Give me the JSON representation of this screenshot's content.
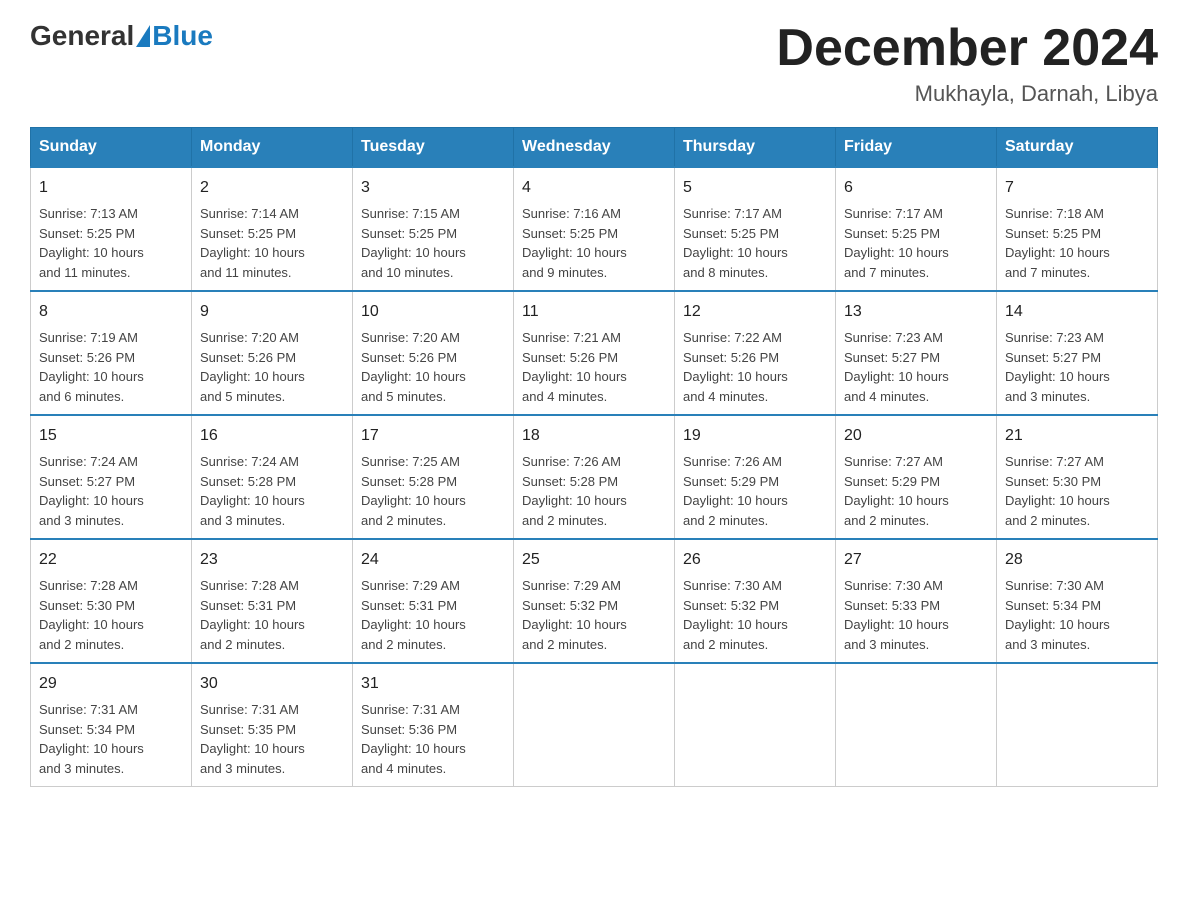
{
  "header": {
    "logo_general": "General",
    "logo_blue": "Blue",
    "month_title": "December 2024",
    "location": "Mukhayla, Darnah, Libya"
  },
  "weekdays": [
    "Sunday",
    "Monday",
    "Tuesday",
    "Wednesday",
    "Thursday",
    "Friday",
    "Saturday"
  ],
  "weeks": [
    [
      {
        "day": "1",
        "sunrise": "7:13 AM",
        "sunset": "5:25 PM",
        "daylight": "10 hours and 11 minutes."
      },
      {
        "day": "2",
        "sunrise": "7:14 AM",
        "sunset": "5:25 PM",
        "daylight": "10 hours and 11 minutes."
      },
      {
        "day": "3",
        "sunrise": "7:15 AM",
        "sunset": "5:25 PM",
        "daylight": "10 hours and 10 minutes."
      },
      {
        "day": "4",
        "sunrise": "7:16 AM",
        "sunset": "5:25 PM",
        "daylight": "10 hours and 9 minutes."
      },
      {
        "day": "5",
        "sunrise": "7:17 AM",
        "sunset": "5:25 PM",
        "daylight": "10 hours and 8 minutes."
      },
      {
        "day": "6",
        "sunrise": "7:17 AM",
        "sunset": "5:25 PM",
        "daylight": "10 hours and 7 minutes."
      },
      {
        "day": "7",
        "sunrise": "7:18 AM",
        "sunset": "5:25 PM",
        "daylight": "10 hours and 7 minutes."
      }
    ],
    [
      {
        "day": "8",
        "sunrise": "7:19 AM",
        "sunset": "5:26 PM",
        "daylight": "10 hours and 6 minutes."
      },
      {
        "day": "9",
        "sunrise": "7:20 AM",
        "sunset": "5:26 PM",
        "daylight": "10 hours and 5 minutes."
      },
      {
        "day": "10",
        "sunrise": "7:20 AM",
        "sunset": "5:26 PM",
        "daylight": "10 hours and 5 minutes."
      },
      {
        "day": "11",
        "sunrise": "7:21 AM",
        "sunset": "5:26 PM",
        "daylight": "10 hours and 4 minutes."
      },
      {
        "day": "12",
        "sunrise": "7:22 AM",
        "sunset": "5:26 PM",
        "daylight": "10 hours and 4 minutes."
      },
      {
        "day": "13",
        "sunrise": "7:23 AM",
        "sunset": "5:27 PM",
        "daylight": "10 hours and 4 minutes."
      },
      {
        "day": "14",
        "sunrise": "7:23 AM",
        "sunset": "5:27 PM",
        "daylight": "10 hours and 3 minutes."
      }
    ],
    [
      {
        "day": "15",
        "sunrise": "7:24 AM",
        "sunset": "5:27 PM",
        "daylight": "10 hours and 3 minutes."
      },
      {
        "day": "16",
        "sunrise": "7:24 AM",
        "sunset": "5:28 PM",
        "daylight": "10 hours and 3 minutes."
      },
      {
        "day": "17",
        "sunrise": "7:25 AM",
        "sunset": "5:28 PM",
        "daylight": "10 hours and 2 minutes."
      },
      {
        "day": "18",
        "sunrise": "7:26 AM",
        "sunset": "5:28 PM",
        "daylight": "10 hours and 2 minutes."
      },
      {
        "day": "19",
        "sunrise": "7:26 AM",
        "sunset": "5:29 PM",
        "daylight": "10 hours and 2 minutes."
      },
      {
        "day": "20",
        "sunrise": "7:27 AM",
        "sunset": "5:29 PM",
        "daylight": "10 hours and 2 minutes."
      },
      {
        "day": "21",
        "sunrise": "7:27 AM",
        "sunset": "5:30 PM",
        "daylight": "10 hours and 2 minutes."
      }
    ],
    [
      {
        "day": "22",
        "sunrise": "7:28 AM",
        "sunset": "5:30 PM",
        "daylight": "10 hours and 2 minutes."
      },
      {
        "day": "23",
        "sunrise": "7:28 AM",
        "sunset": "5:31 PM",
        "daylight": "10 hours and 2 minutes."
      },
      {
        "day": "24",
        "sunrise": "7:29 AM",
        "sunset": "5:31 PM",
        "daylight": "10 hours and 2 minutes."
      },
      {
        "day": "25",
        "sunrise": "7:29 AM",
        "sunset": "5:32 PM",
        "daylight": "10 hours and 2 minutes."
      },
      {
        "day": "26",
        "sunrise": "7:30 AM",
        "sunset": "5:32 PM",
        "daylight": "10 hours and 2 minutes."
      },
      {
        "day": "27",
        "sunrise": "7:30 AM",
        "sunset": "5:33 PM",
        "daylight": "10 hours and 3 minutes."
      },
      {
        "day": "28",
        "sunrise": "7:30 AM",
        "sunset": "5:34 PM",
        "daylight": "10 hours and 3 minutes."
      }
    ],
    [
      {
        "day": "29",
        "sunrise": "7:31 AM",
        "sunset": "5:34 PM",
        "daylight": "10 hours and 3 minutes."
      },
      {
        "day": "30",
        "sunrise": "7:31 AM",
        "sunset": "5:35 PM",
        "daylight": "10 hours and 3 minutes."
      },
      {
        "day": "31",
        "sunrise": "7:31 AM",
        "sunset": "5:36 PM",
        "daylight": "10 hours and 4 minutes."
      },
      null,
      null,
      null,
      null
    ]
  ],
  "labels": {
    "sunrise": "Sunrise:",
    "sunset": "Sunset:",
    "daylight": "Daylight:"
  }
}
